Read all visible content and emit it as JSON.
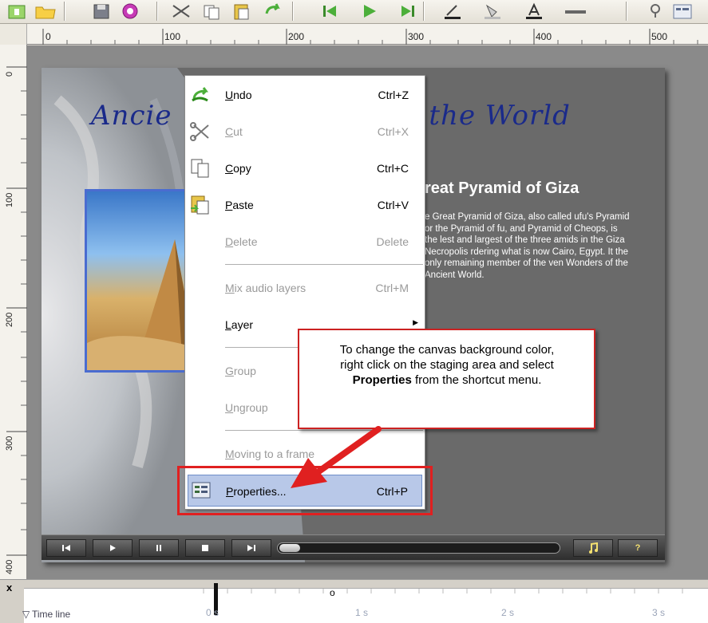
{
  "ruler": {
    "labels": [
      "0",
      "100",
      "200",
      "300",
      "400",
      "500"
    ],
    "vlabels": [
      "0",
      "100",
      "200",
      "300",
      "400"
    ]
  },
  "stage": {
    "title_left": "Ancie",
    "title_right": "f the World",
    "heading": "reat Pyramid of Giza",
    "body": "e Great Pyramid of Giza, also called ufu's Pyramid or the Pyramid of fu, and Pyramid of Cheops, is the lest and largest of the three amids in the Giza Necropolis rdering what is now Cairo, Egypt. It the only remaining member of the ven Wonders of the Ancient World."
  },
  "player": {
    "help_label": "?"
  },
  "menu": {
    "items": [
      {
        "label": "Undo",
        "shortcut": "Ctrl+Z",
        "icon": "undo-icon",
        "enabled": true
      },
      {
        "label": "Cut",
        "shortcut": "Ctrl+X",
        "icon": "scissors-icon",
        "enabled": false
      },
      {
        "label": "Copy",
        "shortcut": "Ctrl+C",
        "icon": "copy-icon",
        "enabled": true
      },
      {
        "label": "Paste",
        "shortcut": "Ctrl+V",
        "icon": "paste-icon",
        "enabled": true
      },
      {
        "label": "Delete",
        "shortcut": "Delete",
        "icon": "",
        "enabled": false
      },
      {
        "label": "Mix audio layers",
        "shortcut": "Ctrl+M",
        "icon": "",
        "enabled": false
      },
      {
        "label": "Layer",
        "shortcut": "",
        "icon": "",
        "enabled": true,
        "submenu": true
      },
      {
        "label": "Group",
        "shortcut": "",
        "icon": "",
        "enabled": false
      },
      {
        "label": "Ungroup",
        "shortcut": "",
        "icon": "",
        "enabled": false
      },
      {
        "label": "Moving to a frame",
        "shortcut": "",
        "icon": "",
        "enabled": false
      },
      {
        "label": "Properties...",
        "shortcut": "Ctrl+P",
        "icon": "properties-icon",
        "enabled": true,
        "selected": true
      }
    ]
  },
  "callout": {
    "line1": "To change the canvas background color,",
    "line2": "right click on the staging area and select",
    "bold": "Properties",
    "line3_rest": " from the shortcut menu."
  },
  "timeline": {
    "label": "Time line",
    "close": "x",
    "ticks": [
      "0 s",
      "1 s",
      "2 s",
      "3 s"
    ],
    "marker": "o"
  },
  "colors": {
    "title_blue": "#1a2a8a",
    "highlight_red": "#e02020",
    "stage_gray": "#6a6a6a",
    "selected_blue": "#b8c8e8"
  }
}
